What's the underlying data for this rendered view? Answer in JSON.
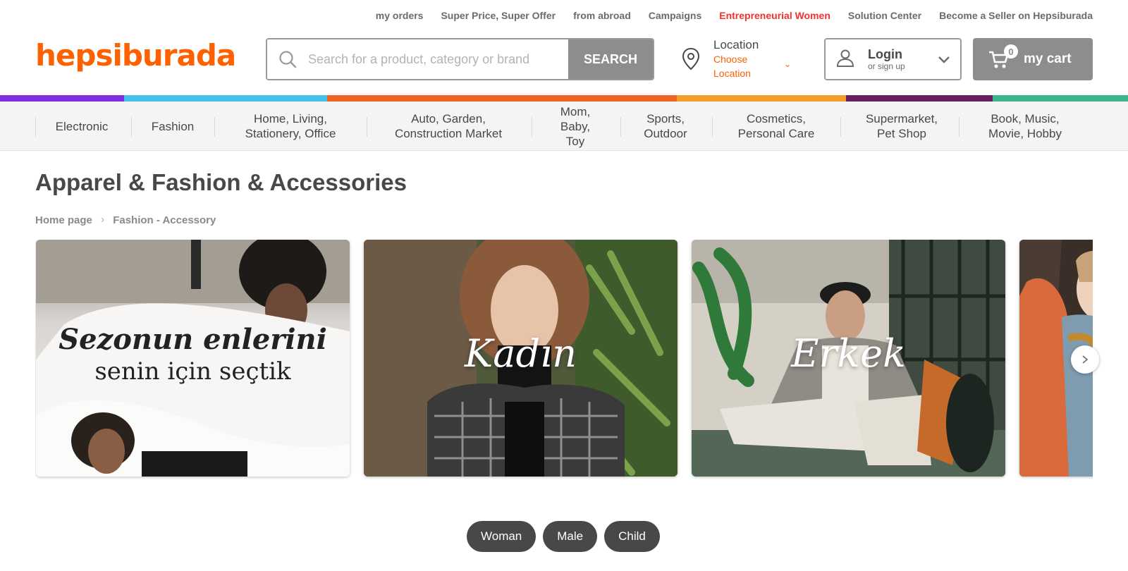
{
  "top_links": [
    {
      "label": "my orders",
      "accent": false
    },
    {
      "label": "Super Price, Super Offer",
      "accent": false
    },
    {
      "label": "from abroad",
      "accent": false
    },
    {
      "label": "Campaigns",
      "accent": false
    },
    {
      "label": "Entrepreneurial Women",
      "accent": true
    },
    {
      "label": "Solution Center",
      "accent": false
    },
    {
      "label": "Become a Seller on Hepsiburada",
      "accent": false
    }
  ],
  "logo": "hepsiburada",
  "search": {
    "placeholder": "Search for a product, category or brand",
    "button": "SEARCH"
  },
  "location": {
    "title": "Location",
    "sub_line1": "Choose",
    "sub_line2": "Location"
  },
  "login": {
    "title": "Login",
    "sub": "or sign up"
  },
  "cart": {
    "label": "my cart",
    "count": "0"
  },
  "colors": {
    "brand": "#ff6000",
    "accent_red": "#f0332f",
    "pill_bg": "#484848",
    "button_gray": "#8d8d8d"
  },
  "color_strip": [
    "#7d2ee0",
    "#45c1e8",
    "#ec6324",
    "#f39b2b",
    "#6a1f60",
    "#3cb48c"
  ],
  "categories": [
    {
      "line1": "Electronic",
      "line2": "",
      "line3": ""
    },
    {
      "line1": "Fashion",
      "line2": "",
      "line3": ""
    },
    {
      "line1": "Home, Living,",
      "line2": "Stationery, Office",
      "line3": ""
    },
    {
      "line1": "Auto, Garden,",
      "line2": "Construction Market",
      "line3": ""
    },
    {
      "line1": "Mom,",
      "line2": "Baby,",
      "line3": "Toy"
    },
    {
      "line1": "Sports,",
      "line2": "Outdoor",
      "line3": ""
    },
    {
      "line1": "Cosmetics,",
      "line2": "Personal Care",
      "line3": ""
    },
    {
      "line1": "Supermarket,",
      "line2": "Pet Shop",
      "line3": ""
    },
    {
      "line1": "Book, Music,",
      "line2": "Movie, Hobby",
      "line3": ""
    }
  ],
  "page_title": "Apparel & Fashion & Accessories",
  "breadcrumb": [
    "Home page",
    "Fashion - Accessory"
  ],
  "banners": [
    {
      "line1": "Sezonun enlerini",
      "line2": "senin için seçtik"
    },
    {
      "word": "Kadın"
    },
    {
      "word": "Erkek"
    },
    {
      "word": ""
    }
  ],
  "filter_pills": [
    "Woman",
    "Male",
    "Child"
  ]
}
